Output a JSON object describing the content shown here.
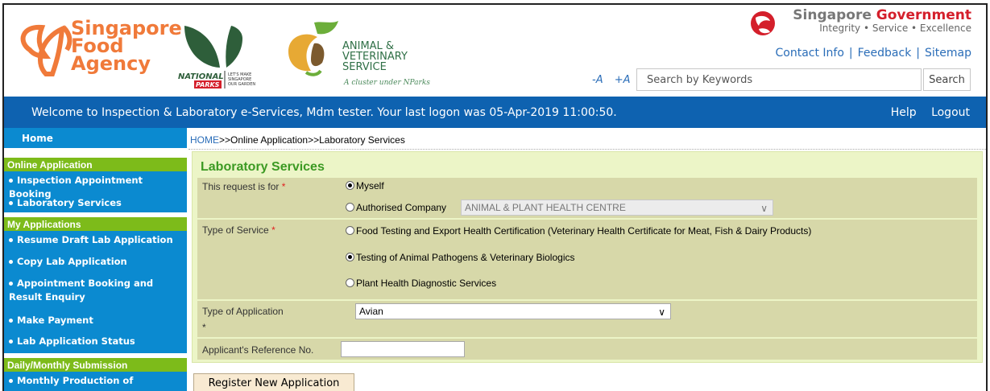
{
  "header": {
    "sfa_logo_lines": [
      "Singapore",
      "Food",
      "Agency"
    ],
    "nparks_logo": {
      "name": "NATIONAL PARKS",
      "tag": "LET'S MAKE SINGAPORE OUR GARDEN"
    },
    "ava_logo": {
      "lines": [
        "ANIMAL &",
        "VETERINARY",
        "SERVICE"
      ],
      "sub": "A cluster under NParks"
    },
    "gov_title_1": "Singapore",
    "gov_title_2": "Government",
    "gov_tagline": "Integrity • Service • Excellence",
    "links": [
      "Contact Info",
      "Feedback",
      "Sitemap"
    ],
    "font_decrease": "-A",
    "font_increase": "+A",
    "search_placeholder": "Search by Keywords",
    "search_button": "Search"
  },
  "welcome": {
    "text": "Welcome to Inspection & Laboratory e-Services, Mdm tester. Your last logon was 05-Apr-2019 11:00:50.",
    "help": "Help",
    "logout": "Logout"
  },
  "sidebar": {
    "home": "Home",
    "sections": [
      {
        "title": "Online Application",
        "items": [
          "Inspection Appointment Booking",
          "Laboratory Services"
        ]
      },
      {
        "title": "My Applications",
        "items": [
          "Resume Draft Lab Application",
          "Copy Lab Application",
          "Appointment Booking and",
          "Make Payment",
          "Lab Application Status"
        ]
      },
      {
        "title": "Daily/Monthly Submission",
        "items": [
          "Monthly Production of"
        ]
      }
    ],
    "item_extra_line": "Result Enquiry"
  },
  "breadcrumb": {
    "home": "HOME",
    "rest": ">>Online Application>>Laboratory Services"
  },
  "form": {
    "title": "Laboratory Services",
    "request_label": "This request is for",
    "request_options": [
      "Myself",
      "Authorised Company"
    ],
    "request_selected": "Myself",
    "company_value": "ANIMAL & PLANT HEALTH CENTRE",
    "service_label": "Type of Service",
    "service_options": [
      "Food Testing and Export Health Certification (Veterinary Health Certificate for Meat, Fish & Dairy Products)",
      "Testing of Animal Pathogens & Veterinary Biologics",
      "Plant Health Diagnostic Services"
    ],
    "service_selected": "Testing of Animal Pathogens & Veterinary Biologics",
    "application_label": "Type of Application",
    "application_value": "Avian",
    "reference_label": "Applicant's Reference No.",
    "reference_value": "",
    "required_mark": "*",
    "register_button": "Register New Application"
  },
  "colors": {
    "welcome_bar": "#0e62b0",
    "sidebar": "#0b8ad0",
    "sidebar_header": "#7dbb1a",
    "form_title": "#3c9a23",
    "form_row": "#d7d8a9",
    "required": "#e02020"
  }
}
